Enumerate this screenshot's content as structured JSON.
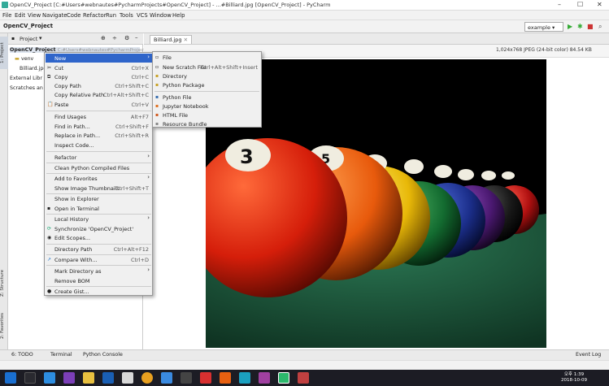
{
  "window": {
    "title": "OpenCV_Project [C:#Users#webnautes#PycharmProjects#OpenCV_Project] - ...#Billiard.jpg [OpenCV_Project] - PyCharm",
    "min": "–",
    "max": "☐",
    "close": "✕"
  },
  "menu": [
    "File",
    "Edit",
    "View",
    "Navigate",
    "Code",
    "Refactor",
    "Run",
    "Tools",
    "VCS",
    "Window",
    "Help"
  ],
  "navbar": {
    "project": "OpenCV_Project",
    "run_config": "example"
  },
  "left_strip": {
    "project_tab": "1: Project",
    "structure_tab": "Z: Structure",
    "favorites_tab": "2: Favorites"
  },
  "project_panel": {
    "header": "Project",
    "tree": [
      "OpenCV_Project",
      "venv",
      "Billiard.jpg",
      "External Libr",
      "Scratches an"
    ],
    "path_hint": "C:#Users#webnautes#PycharmProject"
  },
  "editor": {
    "tab": "Billiard.jpg",
    "image_info": "1,024x768 JPEG (24-bit color) 84.54 KB"
  },
  "context_menu": [
    {
      "label": "New",
      "shortcut": "",
      "arrow": true,
      "selected": true
    },
    {
      "label": "Cut",
      "shortcut": "Ctrl+X",
      "icon": "✂"
    },
    {
      "label": "Copy",
      "shortcut": "Ctrl+C",
      "icon": "⧉"
    },
    {
      "label": "Copy Path",
      "shortcut": "Ctrl+Shift+C"
    },
    {
      "label": "Copy Relative Path",
      "shortcut": "Ctrl+Alt+Shift+C"
    },
    {
      "label": "Paste",
      "shortcut": "Ctrl+V",
      "icon": "📋"
    },
    {
      "label": "Find Usages",
      "shortcut": "Alt+F7"
    },
    {
      "label": "Find in Path...",
      "shortcut": "Ctrl+Shift+F"
    },
    {
      "label": "Replace in Path...",
      "shortcut": "Ctrl+Shift+R"
    },
    {
      "label": "Inspect Code..."
    },
    {
      "label": "Refactor",
      "arrow": true
    },
    {
      "label": "Clean Python Compiled Files"
    },
    {
      "label": "Add to Favorites",
      "arrow": true
    },
    {
      "label": "Show Image Thumbnails",
      "shortcut": "Ctrl+Shift+T"
    },
    {
      "label": "Show in Explorer"
    },
    {
      "label": "Open in Terminal",
      "icon": "▪"
    },
    {
      "label": "Local History",
      "arrow": true
    },
    {
      "label": "Synchronize 'OpenCV_Project'",
      "icon": "⟳"
    },
    {
      "label": "Edit Scopes...",
      "icon": "◉"
    },
    {
      "label": "Directory Path",
      "shortcut": "Ctrl+Alt+F12"
    },
    {
      "label": "Compare With...",
      "shortcut": "Ctrl+D",
      "icon": "↗"
    },
    {
      "label": "Mark Directory as",
      "arrow": true
    },
    {
      "label": "Remove BOM"
    },
    {
      "label": "Create Gist...",
      "icon": "●"
    }
  ],
  "submenu": [
    {
      "label": "File",
      "icon": "▫"
    },
    {
      "label": "New Scratch File",
      "shortcut": "Ctrl+Alt+Shift+Insert",
      "icon": "▫"
    },
    {
      "label": "Directory",
      "icon": "▪"
    },
    {
      "label": "Python Package",
      "icon": "▪"
    },
    {
      "label": "Python File",
      "icon": "▪"
    },
    {
      "label": "Jupyter Notebook",
      "icon": "▪"
    },
    {
      "label": "HTML File",
      "icon": "▪"
    },
    {
      "label": "Resource Bundle",
      "icon": "▪"
    }
  ],
  "bottom": {
    "todo": "6: TODO",
    "terminal": "Terminal",
    "console": "Python Console",
    "eventlog": "Event Log"
  },
  "clock": {
    "time": "오후 1:39",
    "date": "2018-10-09"
  },
  "colors": {
    "selection": "#2f65ca",
    "felt": "#1e5a3c"
  }
}
